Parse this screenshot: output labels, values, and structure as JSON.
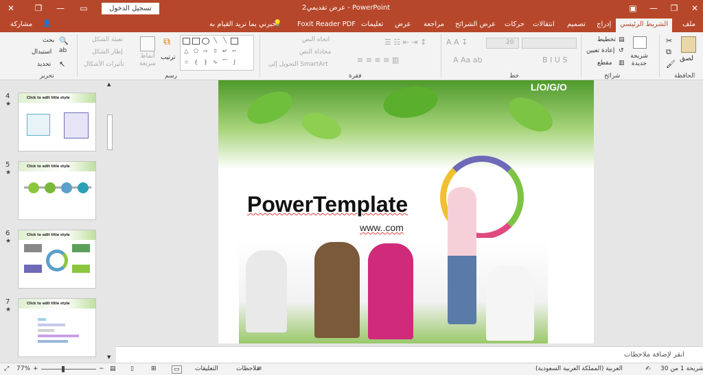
{
  "window": {
    "title": "عرض تقديمي2 - PowerPoint",
    "sign_in": "تسجيل الدخول"
  },
  "tabs": {
    "file": "ملف",
    "home": "الشريط الرئيسي",
    "insert": "إدراج",
    "design": "تصميم",
    "transitions": "انتقالات",
    "animations": "حركات",
    "slideshow": "عرض الشرائح",
    "review": "مراجعة",
    "view": "عرض",
    "comments": "تعليمات",
    "foxit": "Foxit Reader PDF",
    "tell_me": "أخبرني بما تريد القيام به",
    "share": "مشاركة"
  },
  "ribbon": {
    "clipboard": {
      "paste": "لصق",
      "group": "الحافظة"
    },
    "slides": {
      "new_slide": "شريحة جديدة",
      "layout": "تخطيط",
      "reset": "إعادة تعيين",
      "section": "مقطع",
      "group": "شرائح"
    },
    "font": {
      "size": "20",
      "group": "خط"
    },
    "paragraph": {
      "text_direction": "اتجاه النص",
      "align_text": "محاذاة النص",
      "smartart": "التحويل إلى SmartArt",
      "group": "فقرة"
    },
    "drawing": {
      "arrange": "ترتيب",
      "quick_styles": "أنماط سريعة",
      "shape_fill": "تعبئة الشكل",
      "shape_outline": "إطار الشكل",
      "shape_effects": "تأثيرات الأشكال",
      "group": "رسم"
    },
    "editing": {
      "find": "بحث",
      "replace": "استبدال",
      "select": "تحديد",
      "group": "تحرير"
    }
  },
  "thumbnails": [
    {
      "num": "4",
      "title": "Click to edit title style"
    },
    {
      "num": "5",
      "title": "Click to edit title style"
    },
    {
      "num": "6",
      "title": "Click to edit title style"
    },
    {
      "num": "7",
      "title": "Click to edit title style"
    }
  ],
  "slide": {
    "logo": "L/O/G/O",
    "title": "PowerTemplate",
    "url": "www..com"
  },
  "notes_placeholder": "انقر لإضافة ملاحظات",
  "status": {
    "slide_count": "شريحة 1 من 30",
    "language": "العربية (المملكة العربية السعودية)",
    "notes": "ملاحظات",
    "comments": "التعليقات",
    "zoom": "77%"
  },
  "colors": {
    "accent": "#b7472a",
    "ribbon": "#f3f3f3"
  }
}
